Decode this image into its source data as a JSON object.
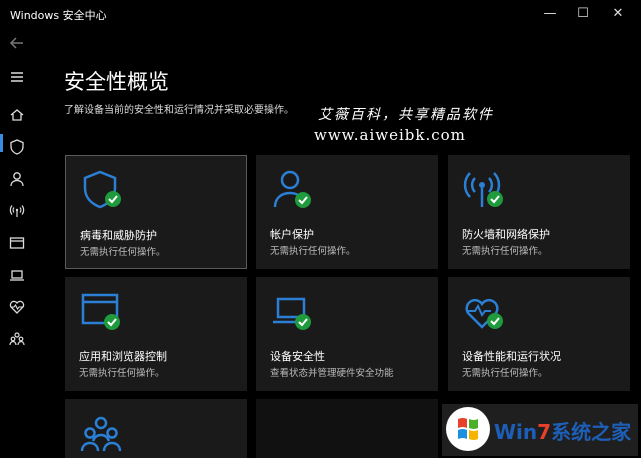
{
  "window": {
    "title": "Windows 安全中心",
    "controls": {
      "minimize": "—",
      "maximize": "☐",
      "close": "✕"
    }
  },
  "sidebar": {
    "back_icon": "back-arrow-icon",
    "items": [
      {
        "icon": "hamburger-menu-icon"
      },
      {
        "icon": "home-icon",
        "active": true
      },
      {
        "icon": "shield-icon"
      },
      {
        "icon": "person-icon"
      },
      {
        "icon": "wifi-antenna-icon"
      },
      {
        "icon": "browser-window-icon"
      },
      {
        "icon": "laptop-icon"
      },
      {
        "icon": "heart-pulse-icon"
      },
      {
        "icon": "family-icon"
      }
    ]
  },
  "header": {
    "title": "安全性概览",
    "subtitle": "了解设备当前的安全性和运行情况并采取必要操作。"
  },
  "watermark": {
    "line1": "艾薇百科，共享精品软件",
    "line2": "www.aiweibk.com"
  },
  "tiles": [
    {
      "title": "病毒和威胁防护",
      "status": "无需执行任何操作。",
      "icon": "shield-check-icon",
      "selected": true
    },
    {
      "title": "帐户保护",
      "status": "无需执行任何操作。",
      "icon": "person-check-icon"
    },
    {
      "title": "防火墙和网络保护",
      "status": "无需执行任何操作。",
      "icon": "wifi-check-icon"
    },
    {
      "title": "应用和浏览器控制",
      "status": "无需执行任何操作。",
      "icon": "browser-check-icon"
    },
    {
      "title": "设备安全性",
      "status": "查看状态并管理硬件安全功能",
      "icon": "laptop-check-icon"
    },
    {
      "title": "设备性能和运行状况",
      "status": "无需执行任何操作。",
      "icon": "heart-check-icon"
    },
    {
      "title": "",
      "status": "",
      "icon": "family-icon"
    }
  ],
  "logo": {
    "text_a": "Win",
    "text_7": "7",
    "text_b": "系统之家"
  },
  "colors": {
    "accent": "#3a8dde",
    "icon_blue": "#2b7fd4",
    "check_green": "#1f9a3c",
    "tile_bg": "#1a1a1a"
  }
}
